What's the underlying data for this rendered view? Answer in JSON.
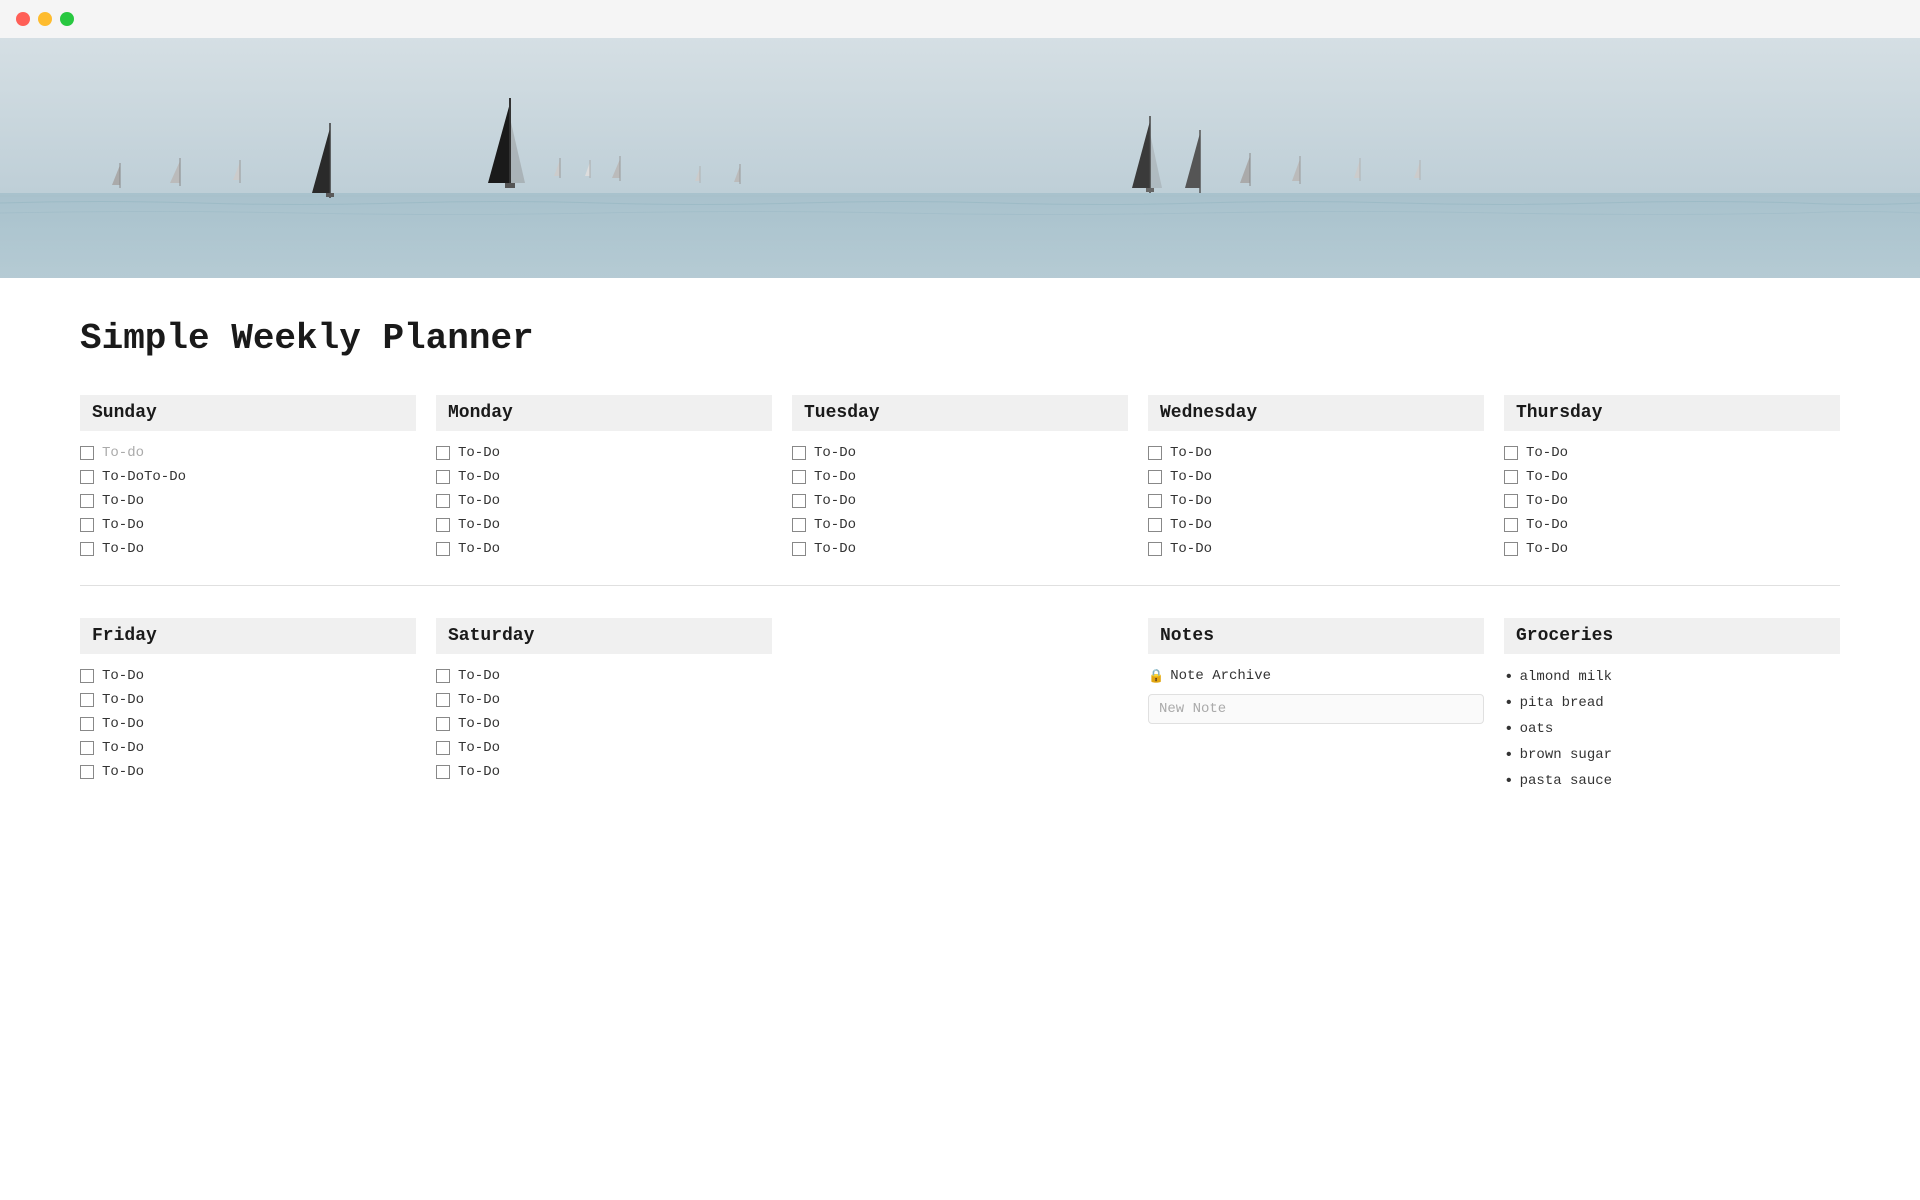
{
  "titlebar": {
    "lights": [
      "red",
      "yellow",
      "green"
    ]
  },
  "page": {
    "title": "Simple Weekly Planner"
  },
  "days_top": [
    {
      "name": "Sunday",
      "items": [
        {
          "label": "To-do",
          "placeholder": true
        },
        {
          "label": "To-DoTo-Do",
          "placeholder": false
        },
        {
          "label": "To-Do",
          "placeholder": false
        },
        {
          "label": "To-Do",
          "placeholder": false
        },
        {
          "label": "To-Do",
          "placeholder": false
        }
      ]
    },
    {
      "name": "Monday",
      "items": [
        {
          "label": "To-Do",
          "placeholder": false
        },
        {
          "label": "To-Do",
          "placeholder": false
        },
        {
          "label": "To-Do",
          "placeholder": false
        },
        {
          "label": "To-Do",
          "placeholder": false
        },
        {
          "label": "To-Do",
          "placeholder": false
        }
      ]
    },
    {
      "name": "Tuesday",
      "items": [
        {
          "label": "To-Do",
          "placeholder": false
        },
        {
          "label": "To-Do",
          "placeholder": false
        },
        {
          "label": "To-Do",
          "placeholder": false
        },
        {
          "label": "To-Do",
          "placeholder": false
        },
        {
          "label": "To-Do",
          "placeholder": false
        }
      ]
    },
    {
      "name": "Wednesday",
      "items": [
        {
          "label": "To-Do",
          "placeholder": false
        },
        {
          "label": "To-Do",
          "placeholder": false
        },
        {
          "label": "To-Do",
          "placeholder": false
        },
        {
          "label": "To-Do",
          "placeholder": false
        },
        {
          "label": "To-Do",
          "placeholder": false
        }
      ]
    },
    {
      "name": "Thursday",
      "items": [
        {
          "label": "To-Do",
          "placeholder": false
        },
        {
          "label": "To-Do",
          "placeholder": false
        },
        {
          "label": "To-Do",
          "placeholder": false
        },
        {
          "label": "To-Do",
          "placeholder": false
        },
        {
          "label": "To-Do",
          "placeholder": false
        }
      ]
    }
  ],
  "days_bottom": [
    {
      "name": "Friday",
      "items": [
        {
          "label": "To-Do",
          "placeholder": false
        },
        {
          "label": "To-Do",
          "placeholder": false
        },
        {
          "label": "To-Do",
          "placeholder": false
        },
        {
          "label": "To-Do",
          "placeholder": false
        },
        {
          "label": "To-Do",
          "placeholder": false
        }
      ]
    },
    {
      "name": "Saturday",
      "items": [
        {
          "label": "To-Do",
          "placeholder": false
        },
        {
          "label": "To-Do",
          "placeholder": false
        },
        {
          "label": "To-Do",
          "placeholder": false
        },
        {
          "label": "To-Do",
          "placeholder": false
        },
        {
          "label": "To-Do",
          "placeholder": false
        }
      ]
    }
  ],
  "notes": {
    "header": "Notes",
    "archive_label": "Note Archive",
    "new_note_placeholder": "New Note"
  },
  "groceries": {
    "header": "Groceries",
    "items": [
      "almond milk",
      "pita bread",
      "oats",
      "brown sugar",
      "pasta sauce"
    ]
  }
}
